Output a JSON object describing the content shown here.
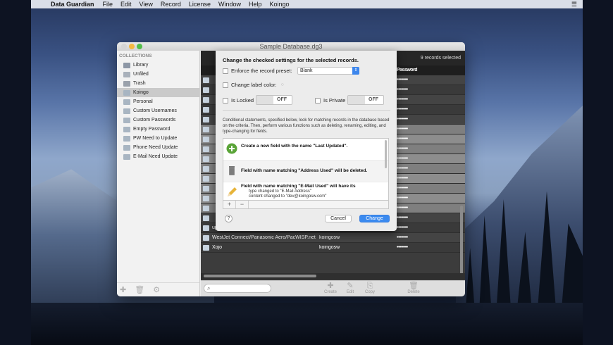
{
  "menubar": {
    "app_name": "Data Guardian",
    "items": [
      "File",
      "Edit",
      "View",
      "Record",
      "License",
      "Window",
      "Help",
      "Koingo"
    ]
  },
  "window": {
    "title": "Sample Database.dg3",
    "records_selected": "9 records selected",
    "password_header": "Password"
  },
  "sidebar": {
    "heading": "COLLECTIONS",
    "items": [
      {
        "label": "Library",
        "icon": "library-icon",
        "color": "#8d97a6"
      },
      {
        "label": "Unfiled",
        "icon": "unfiled-icon",
        "color": "#a9b1bb"
      },
      {
        "label": "Trash",
        "icon": "trash-icon",
        "color": "#9aa1ab"
      },
      {
        "label": "Koingo",
        "icon": "folder-icon",
        "color": "#a8b5c2",
        "selected": true
      },
      {
        "label": "Personal",
        "icon": "folder-icon",
        "color": "#a8b5c2"
      },
      {
        "label": "Custom Usernames",
        "icon": "smart-folder-icon",
        "color": "#a8b5c2"
      },
      {
        "label": "Custom Passwords",
        "icon": "smart-folder-icon",
        "color": "#a8b5c2"
      },
      {
        "label": "Empty Password",
        "icon": "smart-folder-icon",
        "color": "#a8b5c2"
      },
      {
        "label": "PW Need to Update",
        "icon": "smart-folder-icon",
        "color": "#a8b5c2"
      },
      {
        "label": "Phone Need Update",
        "icon": "smart-folder-icon",
        "color": "#a8b5c2"
      },
      {
        "label": "E-Mail Need Update",
        "icon": "smart-folder-icon",
        "color": "#a8b5c2"
      }
    ]
  },
  "table": {
    "rows": [
      {
        "name": "",
        "user": "",
        "password": "••••••••",
        "grey": false
      },
      {
        "name": "",
        "user": "",
        "password": "••••••••",
        "grey": false
      },
      {
        "name": "",
        "user": "",
        "password": "••••••••",
        "grey": false
      },
      {
        "name": "",
        "user": "",
        "password": "••••••••",
        "grey": false
      },
      {
        "name": "",
        "user": "",
        "password": "••••••••",
        "grey": false
      },
      {
        "name": "",
        "user": "",
        "password": "••••••••",
        "grey": true
      },
      {
        "name": "",
        "user": "",
        "password": "••••••••",
        "grey": true
      },
      {
        "name": "",
        "user": "om",
        "password": "••••••••",
        "grey": true
      },
      {
        "name": "",
        "user": "",
        "password": "••••••••",
        "grey": true
      },
      {
        "name": "",
        "user": "",
        "password": "••••••••",
        "grey": true
      },
      {
        "name": "",
        "user": "",
        "password": "••••••••",
        "grey": true
      },
      {
        "name": "",
        "user": "",
        "password": "••••••••",
        "grey": true
      },
      {
        "name": "",
        "user": "",
        "password": "••••••••",
        "grey": true
      },
      {
        "name": "",
        "user": "",
        "password": "••••••••",
        "grey": true
      },
      {
        "name": "",
        "user": "",
        "password": "••••••••",
        "grey": false
      },
      {
        "name": "upwork.com (oDesk)",
        "user": "koingosw",
        "password": "••••••••",
        "grey": false
      },
      {
        "name": "WestJet Connect/Panasonic Aero/PacWISP.net",
        "user": "koingosw",
        "password": "••••••••",
        "grey": false
      },
      {
        "name": "Xojo",
        "user": "koingosw",
        "password": "••••••••",
        "grey": false
      }
    ]
  },
  "toolbar": {
    "create": "Create",
    "edit": "Edit",
    "copy": "Copy",
    "delete": "Delete"
  },
  "sheet": {
    "title": "Change the checked settings for the selected records.",
    "enforce_preset": "Enforce the record preset:",
    "preset_value": "Blank",
    "change_label_color": "Change label color:",
    "is_locked": "Is Locked",
    "is_private": "Is Private",
    "off": "OFF",
    "description": "Conditional statements, specified below, look for matching records in the database based on the criteria. Then, perform various functions such as deleting, renaming, editing, and type-changing for fields.",
    "actions": [
      {
        "text": "Create a new field with the name \"Last Updated\".",
        "icon": "add-icon"
      },
      {
        "text": "Field with name matching \"Address Used\" will be deleted.",
        "icon": "trash-can-icon"
      },
      {
        "text": "Field with name matching \"E-Mail Used\" will have its",
        "icon": "pencil-icon",
        "sub1": "type changed to \"E-Mail Address\"",
        "sub2": "content changed to \"dev@koingosw.com\""
      }
    ],
    "add": "+",
    "remove": "−",
    "help": "?",
    "cancel": "Cancel",
    "change": "Change"
  }
}
